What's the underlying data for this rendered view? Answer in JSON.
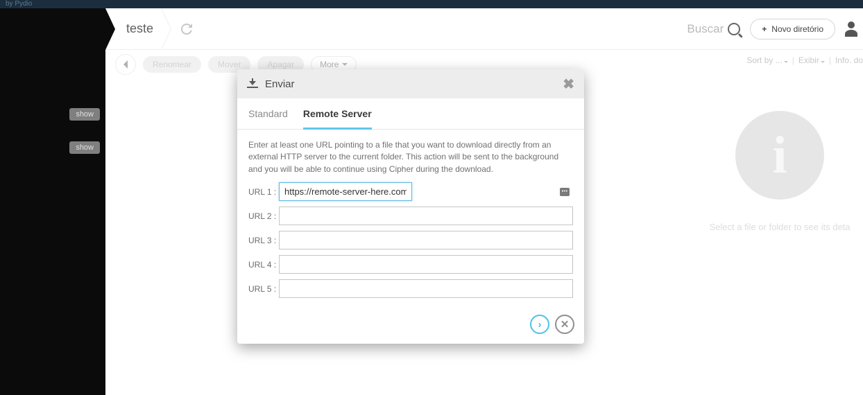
{
  "topbar": {
    "brand": "by Pydio"
  },
  "breadcrumb": {
    "title": "teste"
  },
  "header": {
    "search_label": "Buscar",
    "new_dir_label": "Novo diretório"
  },
  "sidebar": {
    "show1": "show",
    "show2": "show"
  },
  "toolbar": {
    "rename": "Renomear",
    "move": "Mover",
    "delete": "Apagar",
    "more": "More"
  },
  "meta": {
    "sortby": "Sort by ...",
    "exibir": "Exibir",
    "info": "Info. do"
  },
  "detail": {
    "placeholder": "Select a file or folder to see its deta"
  },
  "modal": {
    "title": "Enviar",
    "tabs": {
      "standard": "Standard",
      "remote": "Remote Server"
    },
    "desc": "Enter at least one URL pointing to a file that you want to download directly from an external HTTP server to the current folder. This action will be sent to the background and you will be able to continue using Cipher during the download.",
    "labels": {
      "u1": "URL 1 :",
      "u2": "URL 2 :",
      "u3": "URL 3 :",
      "u4": "URL 4 :",
      "u5": "URL 5 :"
    },
    "values": {
      "u1": "https://remote-server-here.com",
      "u2": "",
      "u3": "",
      "u4": "",
      "u5": ""
    }
  }
}
